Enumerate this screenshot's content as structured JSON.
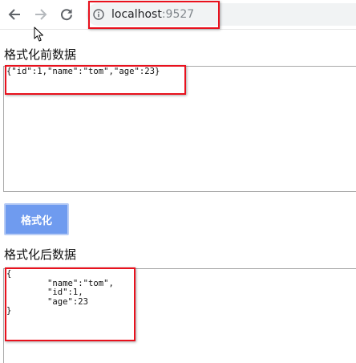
{
  "browser": {
    "url_host": "localhost",
    "url_port": ":9527",
    "icons": {
      "back": "back-arrow-icon",
      "forward": "forward-arrow-icon",
      "reload": "reload-icon",
      "site_info": "info-icon",
      "cursor": "mouse-cursor-icon"
    }
  },
  "page": {
    "before_label": "格式化前数据",
    "before_data": "{\"id\":1,\"name\":\"tom\",\"age\":23}",
    "format_button_label": "格式化",
    "after_label": "格式化后数据",
    "after_data": "{\n        \"name\":\"tom\",\n        \"id\":1,\n        \"age\":23\n}"
  },
  "colors": {
    "annotation": "#e8111d",
    "button_bg": "#6f9bef",
    "button_text": "#ffffff"
  }
}
